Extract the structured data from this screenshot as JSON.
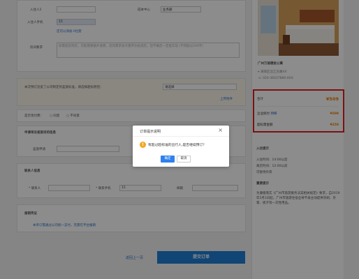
{
  "form": {
    "occupant": {
      "name_label": "入住人2",
      "cost_center_label": "成本中心",
      "cost_center_value": "业务部",
      "phone_label": "入住人手机",
      "phone_value": "15",
      "note_link": "还可以添加 0位客",
      "remark_label": "房间要求",
      "remark_placeholder": "如需提前到店，可能需要额外收费，您的需求会尽量传达给酒店，但不确定一定能实现 (不得超过200字)"
    },
    "policy": {
      "text": "本次预订违反了公司制定的差旅标准，请选择超标原因：",
      "select_value": "请选择",
      "upload_link": "上传附件"
    },
    "payment": {
      "label": "是否现付费：",
      "opt_yes": "同意",
      "opt_no": "不同意"
    },
    "apply": {
      "title": "申请单及差旅目的信息",
      "field_label": "差旅申请"
    },
    "contact": {
      "title": "联系人信息",
      "name_label": "联系人",
      "phone_label": "联系手机",
      "phone_value": "15",
      "email_label": "邮箱"
    },
    "invoice": {
      "title": "报销凭证",
      "text": "本单订需通过公司统一支付，无需在平台报销"
    }
  },
  "actions": {
    "back": "返回上一页",
    "submit": "提交订单"
  },
  "hotel": {
    "name": "广州万丽德金公寓",
    "addr": "海珠区沿江东路XX",
    "phone": "020-36037866-XXX"
  },
  "price": {
    "total_label": "合计",
    "total_value": "¥509",
    "row1_label": "企业统付",
    "row1_tag": "明细",
    "row1_value": "¥509",
    "row2_label": "超标需金额",
    "row2_value": "¥259"
  },
  "notice": {
    "title": "入住提示",
    "checkin": "入住时间：14:00以后",
    "checkout": "离店时间：12:00以前",
    "extra": "可接待外宾",
    "important_title": "重要提示",
    "important_text": "为遵循落实《广州市旅游服务法案相关规定》要求，自2019年5月1日起，广州市旅游住宿业将不再主动提供牙刷、牙膏、梳子等一次性用品。"
  },
  "dialog": {
    "title": "订单提示说明",
    "message": "有超过超标准的出行人,是否继续预订？",
    "ok": "确定",
    "cancel": "取消",
    "close": "×",
    "warn_glyph": "!"
  },
  "colors": {
    "accent": "#2f80ed",
    "warn": "#f5a623",
    "price": "#f07d00",
    "highlight_border": "#e02020"
  }
}
